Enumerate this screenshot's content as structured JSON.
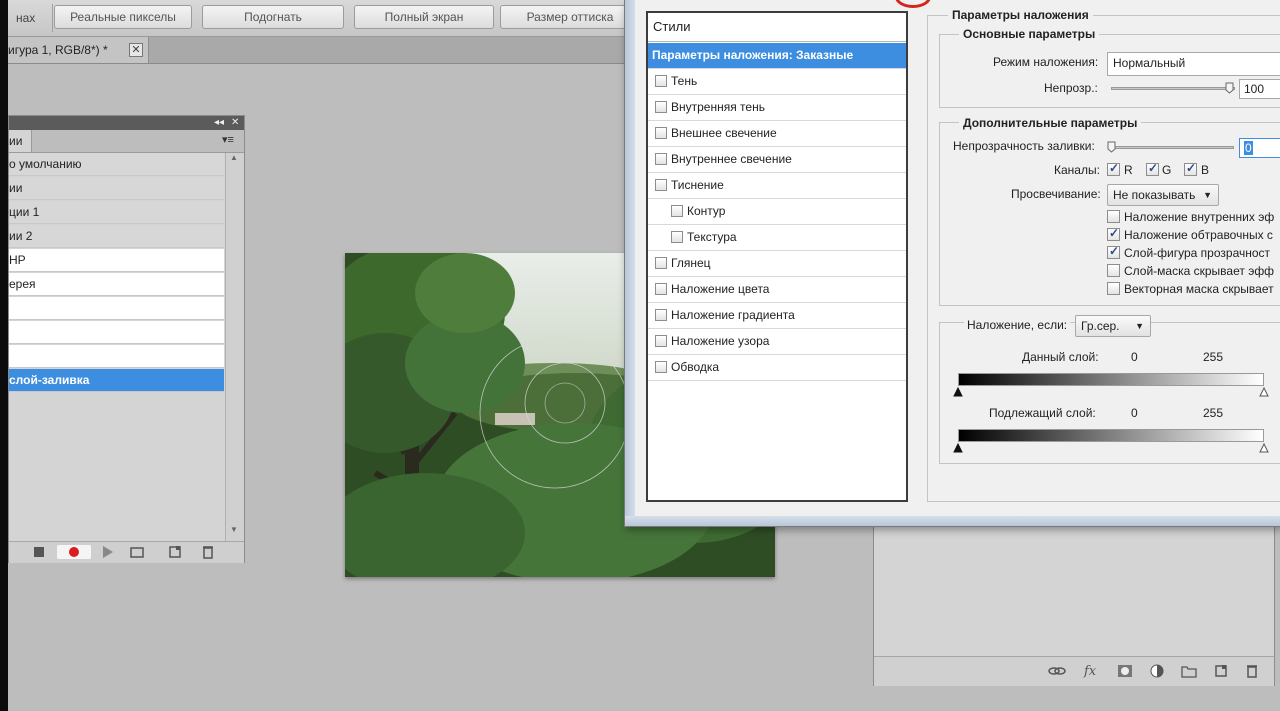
{
  "options_bar": {
    "lead_fragment": "нах",
    "buttons": [
      "Реальные пикселы",
      "Подогнать",
      "Полный экран",
      "Размер оттиска"
    ]
  },
  "document_tab": {
    "label": "игура 1, RGB/8*) *",
    "close_glyph": "✕"
  },
  "actions_panel": {
    "tab_label": "ии",
    "rows": [
      {
        "label": "о умолчанию",
        "kind": "set"
      },
      {
        "label": "ии",
        "kind": "set"
      },
      {
        "label": "ции 1",
        "kind": "set"
      },
      {
        "label": "ии 2",
        "kind": "set"
      },
      {
        "label": "HP",
        "kind": "item"
      },
      {
        "label": "ерея",
        "kind": "item"
      },
      {
        "label": "",
        "kind": "item"
      },
      {
        "label": "",
        "kind": "item"
      },
      {
        "label": "",
        "kind": "item"
      },
      {
        "label": "слой-заливка",
        "kind": "selected"
      }
    ]
  },
  "layer_style_dialog": {
    "styles_header": "Стили",
    "styles": [
      {
        "label": "Параметры наложения: Заказные",
        "selected": true,
        "checkbox": false,
        "indent": false
      },
      {
        "label": "Тень",
        "checkbox": true,
        "indent": false
      },
      {
        "label": "Внутренняя тень",
        "checkbox": true,
        "indent": false
      },
      {
        "label": "Внешнее свечение",
        "checkbox": true,
        "indent": false
      },
      {
        "label": "Внутреннее свечение",
        "checkbox": true,
        "indent": false
      },
      {
        "label": "Тиснение",
        "checkbox": true,
        "indent": false
      },
      {
        "label": "Контур",
        "checkbox": true,
        "indent": true
      },
      {
        "label": "Текстура",
        "checkbox": true,
        "indent": true
      },
      {
        "label": "Глянец",
        "checkbox": true,
        "indent": false
      },
      {
        "label": "Наложение цвета",
        "checkbox": true,
        "indent": false
      },
      {
        "label": "Наложение градиента",
        "checkbox": true,
        "indent": false
      },
      {
        "label": "Наложение узора",
        "checkbox": true,
        "indent": false
      },
      {
        "label": "Обводка",
        "checkbox": true,
        "indent": false
      }
    ],
    "blending_options": {
      "title": "Параметры наложения",
      "general": {
        "title": "Основные параметры",
        "blend_mode_label": "Режим наложения:",
        "blend_mode_value": "Нормальный",
        "opacity_label": "Непрозр.:",
        "opacity_value": "100",
        "opacity_level": 1.0
      },
      "advanced": {
        "title": "Дополнительные параметры",
        "fill_opacity_label": "Непрозрачность заливки:",
        "fill_opacity_value": "0",
        "fill_opacity_level": 0.0,
        "channels_label": "Каналы:",
        "channels": [
          {
            "label": "R",
            "checked": true
          },
          {
            "label": "G",
            "checked": true
          },
          {
            "label": "B",
            "checked": true
          }
        ],
        "knockout_label": "Просвечивание:",
        "knockout_value": "Не показывать",
        "options": [
          {
            "label": "Наложение внутренних эф",
            "checked": false
          },
          {
            "label": "Наложение обтравочных с",
            "checked": true
          },
          {
            "label": "Слой-фигура прозрачност",
            "checked": true
          },
          {
            "label": "Слой-маска скрывает эфф",
            "checked": false
          },
          {
            "label": "Векторная маска скрывает",
            "checked": false
          }
        ]
      },
      "blend_if": {
        "label": "Наложение, если:",
        "value": "Гр.сер.",
        "this_layer_label": "Данный слой:",
        "this_layer_min": "0",
        "this_layer_max": "255",
        "underlying_label": "Подлежащий слой:",
        "underlying_min": "0",
        "underlying_max": "255"
      }
    }
  },
  "colors": {
    "selection": "#3d8ee0",
    "annotation_circle": "#d2261e",
    "record_button": "#d81e1e"
  },
  "icons": {
    "actions_footer": [
      "stop-icon",
      "record-icon",
      "play-icon",
      "new-set-icon",
      "new-action-icon",
      "delete-icon"
    ],
    "layers_footer": [
      "link-icon",
      "fx-icon",
      "mask-icon",
      "adjustment-icon",
      "group-icon",
      "new-layer-icon",
      "delete-icon"
    ]
  }
}
